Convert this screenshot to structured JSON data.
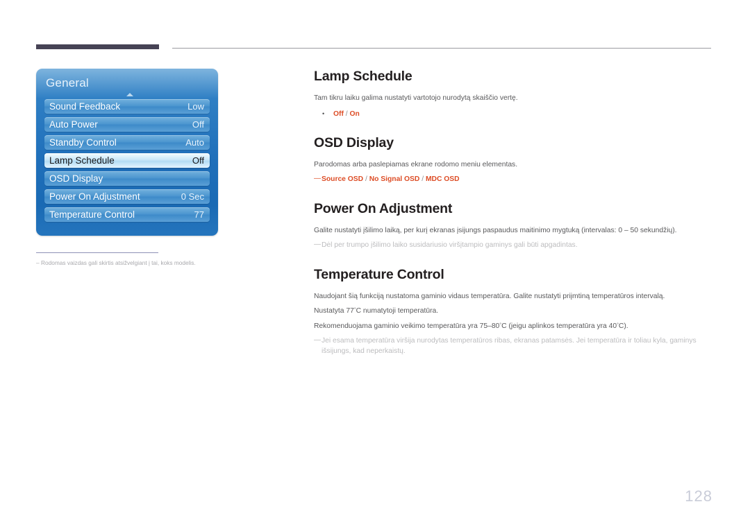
{
  "header": {
    "rule_left_color": "#464355",
    "rule_right_color": "#9a9a9f"
  },
  "osd_panel": {
    "title": "General",
    "arrow_icon": "caret-up-icon",
    "rows": [
      {
        "label": "Sound Feedback",
        "value": "Low",
        "selected": false
      },
      {
        "label": "Auto Power",
        "value": "Off",
        "selected": false
      },
      {
        "label": "Standby Control",
        "value": "Auto",
        "selected": false
      },
      {
        "label": "Lamp Schedule",
        "value": "Off",
        "selected": true
      },
      {
        "label": "OSD Display",
        "value": "",
        "selected": false
      },
      {
        "label": "Power On Adjustment",
        "value": "0 Sec",
        "selected": false
      },
      {
        "label": "Temperature Control",
        "value": "77",
        "selected": false
      }
    ]
  },
  "left_note": {
    "dash": "–",
    "text": "Rodomas vaizdas gali skirtis atsižvelgiant į tai, koks modelis."
  },
  "sections": [
    {
      "title": "Lamp Schedule",
      "paragraph": "Tam tikru laiku galima nustatyti vartotojo nurodytą skaiščio vertę.",
      "bullet_mark": "•",
      "options": [
        "Off",
        "On"
      ],
      "option_separator": "/"
    },
    {
      "title": "OSD Display",
      "paragraph": "Parodomas arba paslepiamas ekrane rodomo meniu elementas.",
      "dash_mark": "—",
      "options": [
        "Source OSD",
        "No Signal OSD",
        "MDC OSD"
      ],
      "option_separator": "/"
    },
    {
      "title": "Power On Adjustment",
      "paragraph": "Galite nustatyti įšilimo laiką, per kurį ekranas įsijungs paspaudus maitinimo mygtuką (intervalas: 0 – 50 sekundžių).",
      "dash_mark": "—",
      "note": "Dėl per trumpo įšilimo laiko susidariusio viršįtampio gaminys gali būti apgadintas."
    },
    {
      "title": "Temperature Control",
      "paragraph1": "Naudojant šią funkciją nustatoma gaminio vidaus temperatūra. Galite nustatyti priįmtiną temperatūros intervalą.",
      "paragraph2_pre": "Nustatyta 77",
      "paragraph2_deg": "°",
      "paragraph2_post": "C numatytoji temperatūra.",
      "paragraph3_pre": "Rekomenduojama gaminio veikimo temperatūra yra 75–80",
      "paragraph3_mid": "C (jeigu aplinkos temperatūra yra 40",
      "paragraph3_post": "C).",
      "dash_mark": "—",
      "note": "Jei esama temperatūra viršija nurodytas temperatūros ribas, ekranas patamsės. Jei temperatūra ir toliau kyla, gaminys išsijungs, kad neperkaistų."
    }
  ],
  "page_number": "128",
  "colors": {
    "accent_orange": "#dd4d26",
    "heading": "#231f20",
    "body_text": "#58585a",
    "muted_text": "#bcbcbe",
    "panel_blue": "#1f6fba",
    "page_number": "#c9ccd8"
  }
}
